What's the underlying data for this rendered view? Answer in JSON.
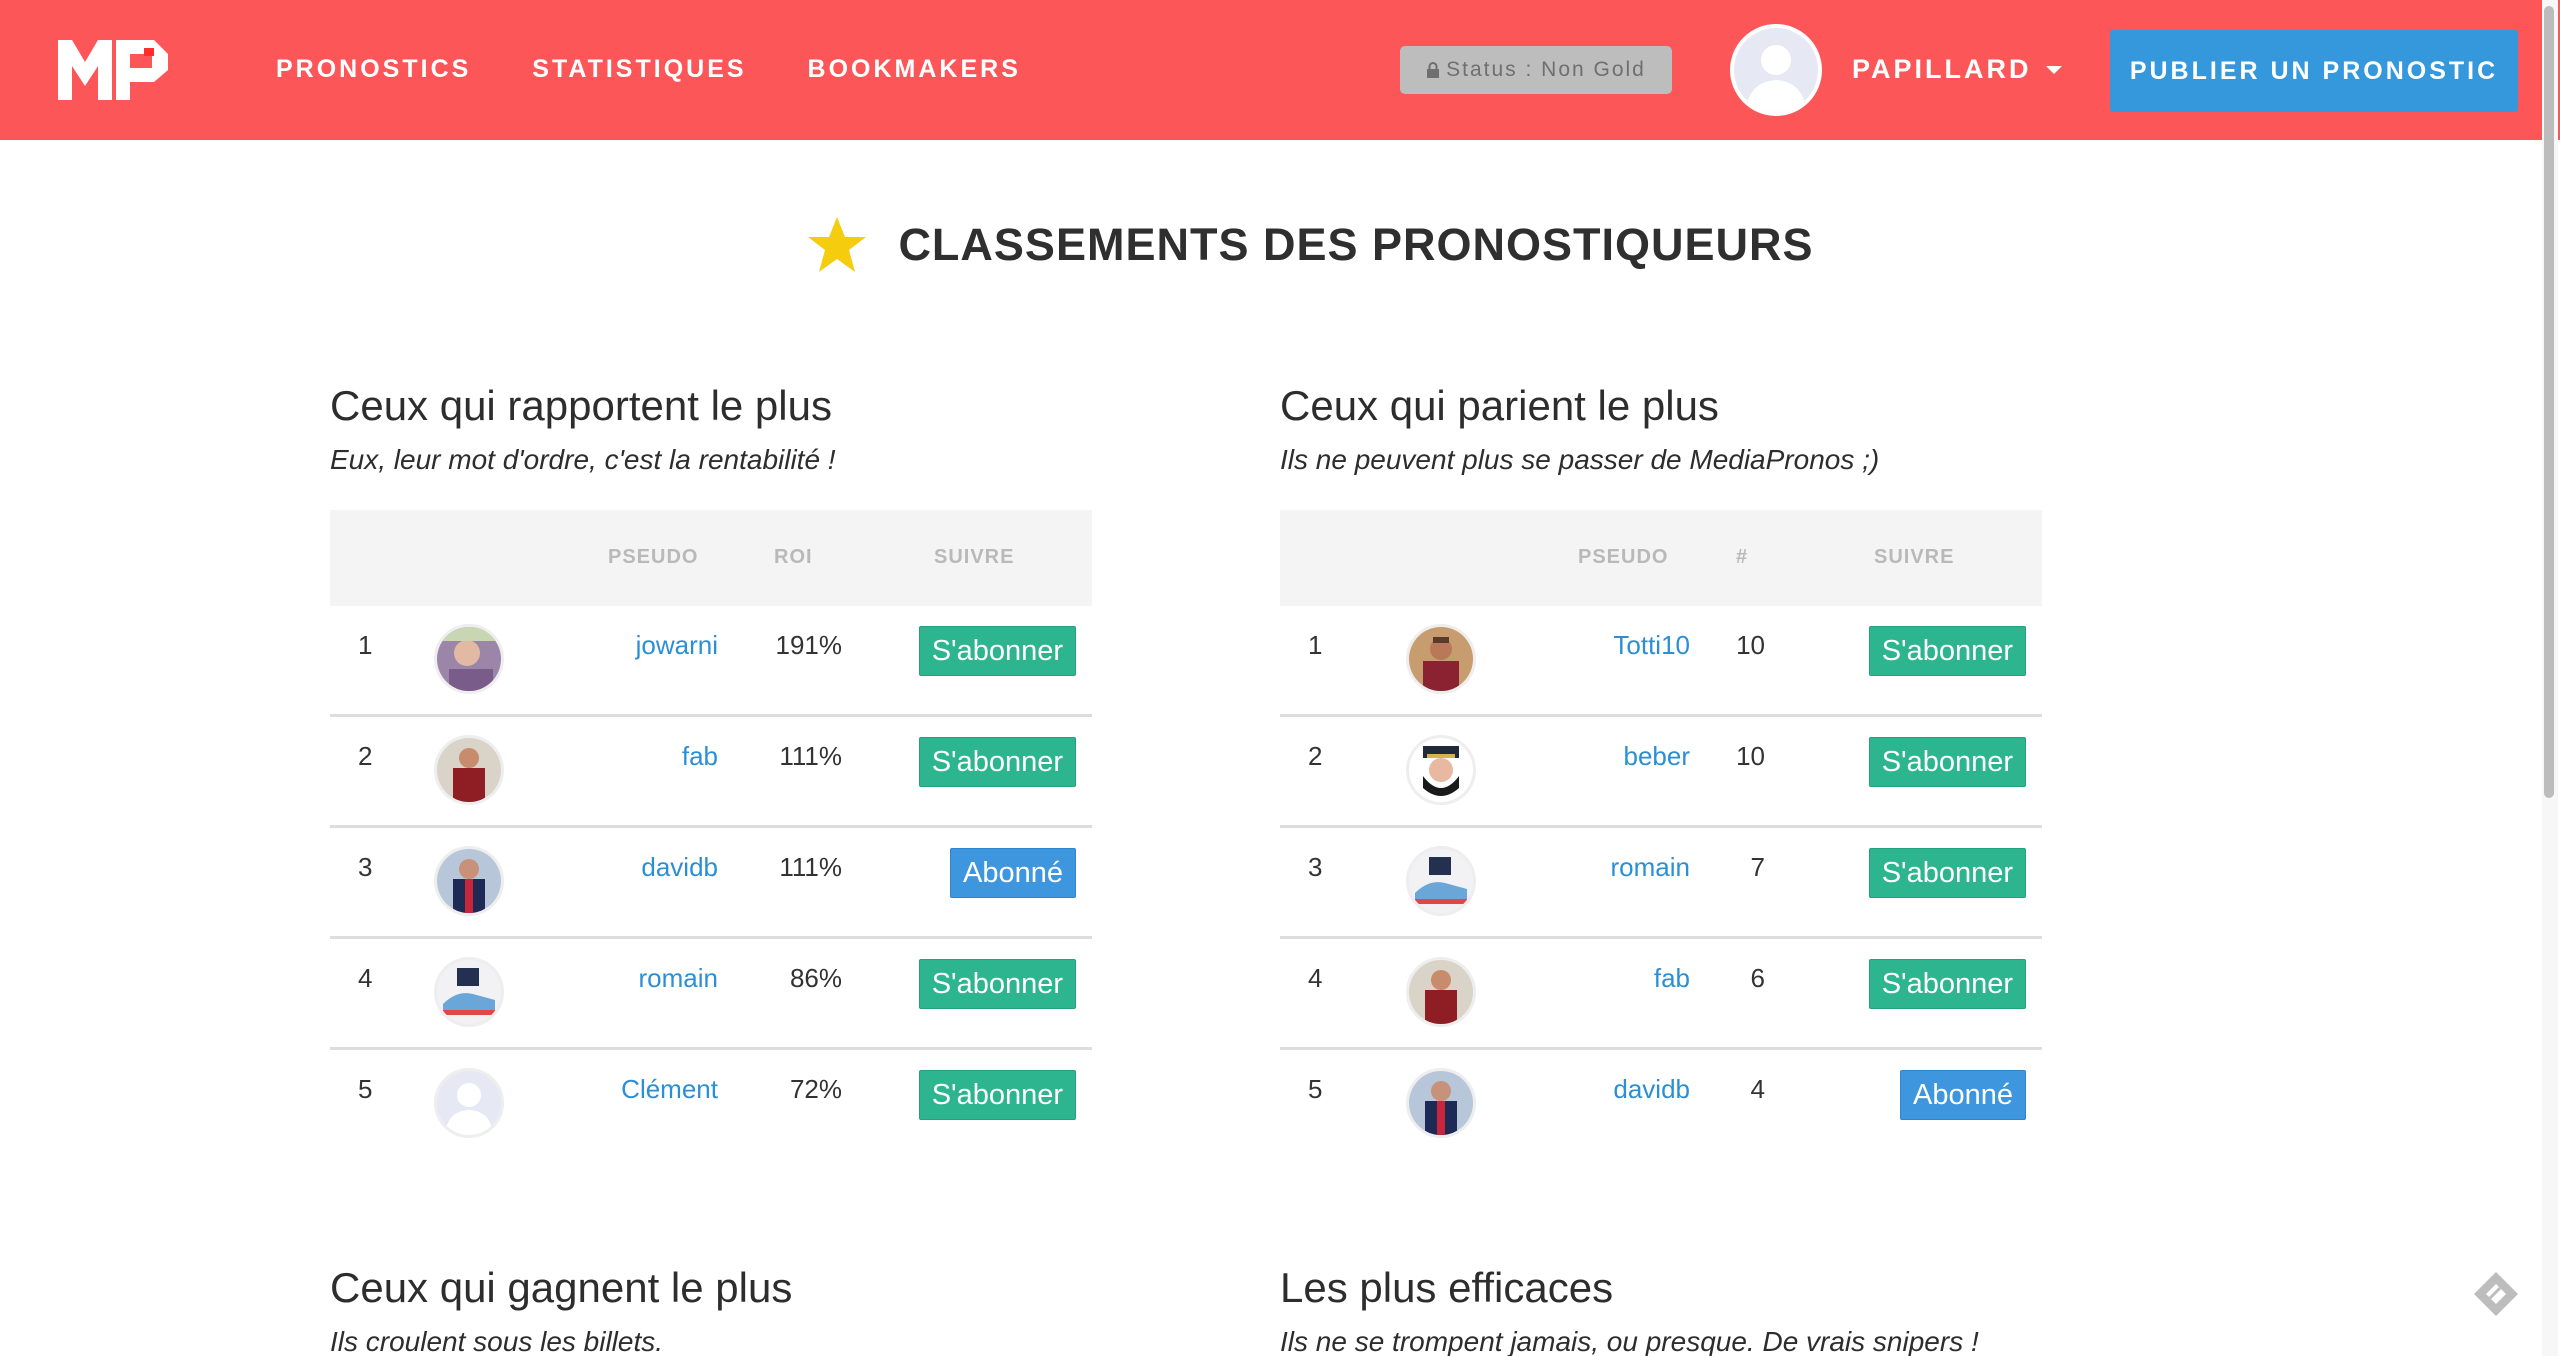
{
  "brand": {
    "logo_text": "MP",
    "color": "#fd5659"
  },
  "nav": {
    "links": [
      "PRONOSTICS",
      "STATISTIQUES",
      "BOOKMAKERS"
    ]
  },
  "status": {
    "label": "Status : Non Gold"
  },
  "user": {
    "name": "PAPILLARD"
  },
  "publish": {
    "label": "PUBLIER UN PRONOSTIC"
  },
  "page": {
    "title": "CLASSEMENTS DES PRONOSTIQUEURS"
  },
  "sections": [
    {
      "title": "Ceux qui rapportent le plus",
      "subtitle": "Eux, leur mot d'ordre, c'est la rentabilité !",
      "headers": {
        "pseudo": "PSEUDO",
        "value": "ROI",
        "follow": "SUIVRE"
      },
      "rows": [
        {
          "rank": "1",
          "pseudo": "jowarni",
          "value": "191%",
          "action": "S'abonner",
          "followed": false,
          "avatar": "person-photo"
        },
        {
          "rank": "2",
          "pseudo": "fab",
          "value": "111%",
          "action": "S'abonner",
          "followed": false,
          "avatar": "player-red-shirt"
        },
        {
          "rank": "3",
          "pseudo": "davidb",
          "value": "111%",
          "action": "Abonné",
          "followed": true,
          "avatar": "player-psg"
        },
        {
          "rank": "4",
          "pseudo": "romain",
          "value": "86%",
          "action": "S'abonner",
          "followed": false,
          "avatar": "sneaker"
        },
        {
          "rank": "5",
          "pseudo": "Clément",
          "value": "72%",
          "action": "S'abonner",
          "followed": false,
          "avatar": "default-user"
        }
      ]
    },
    {
      "title": "Ceux qui parient le plus",
      "subtitle": "Ils ne peuvent plus se passer de MediaPronos ;)",
      "headers": {
        "pseudo": "PSEUDO",
        "value": "#",
        "follow": "SUIVRE"
      },
      "rows": [
        {
          "rank": "1",
          "pseudo": "Totti10",
          "value": "10",
          "action": "S'abonner",
          "followed": false,
          "avatar": "player-roma"
        },
        {
          "rank": "2",
          "pseudo": "beber",
          "value": "10",
          "action": "S'abonner",
          "followed": false,
          "avatar": "captain-cartoon"
        },
        {
          "rank": "3",
          "pseudo": "romain",
          "value": "7",
          "action": "S'abonner",
          "followed": false,
          "avatar": "sneaker"
        },
        {
          "rank": "4",
          "pseudo": "fab",
          "value": "6",
          "action": "S'abonner",
          "followed": false,
          "avatar": "player-red-shirt"
        },
        {
          "rank": "5",
          "pseudo": "davidb",
          "value": "4",
          "action": "Abonné",
          "followed": true,
          "avatar": "player-psg"
        }
      ]
    },
    {
      "title": "Ceux qui gagnent le plus",
      "subtitle": "Ils croulent sous les billets."
    },
    {
      "title": "Les plus efficaces",
      "subtitle": "Ils ne se trompent jamais, ou presque. De vrais snipers !"
    }
  ],
  "colors": {
    "follow_button": "#2cb58e",
    "followed_button": "#3d96de",
    "link": "#2b8fd6",
    "publish_button": "#3598dc",
    "star": "#f5cd0e"
  }
}
